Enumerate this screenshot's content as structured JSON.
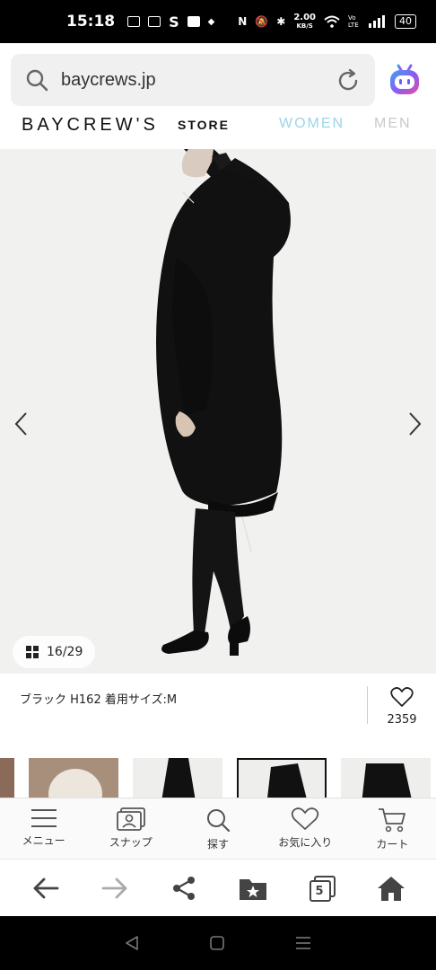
{
  "status_bar": {
    "time": "15:18",
    "net_speed_value": "2.00",
    "net_speed_unit": "KB/S",
    "volte": "Vo LTE",
    "battery": "40"
  },
  "browser": {
    "url": "baycrews.jp"
  },
  "site": {
    "logo": "BAYCREW'S",
    "logo_sub": "STORE",
    "nav": [
      "WOMEN",
      "MEN"
    ]
  },
  "product": {
    "image_index": "16",
    "image_total": "29",
    "caption": "ブラック H162 着用サイズ:M",
    "like_count": "2359"
  },
  "app_nav": [
    {
      "label": "メニュー",
      "icon": "menu-icon"
    },
    {
      "label": "スナップ",
      "icon": "snap-icon"
    },
    {
      "label": "探す",
      "icon": "search-icon"
    },
    {
      "label": "お気に入り",
      "icon": "heart-icon"
    },
    {
      "label": "カート",
      "icon": "cart-icon"
    }
  ],
  "browser_nav": {
    "tabs_count": "5"
  },
  "colors": {
    "women_accent": "#9dd4e8",
    "men_muted": "#c9c9c9"
  }
}
